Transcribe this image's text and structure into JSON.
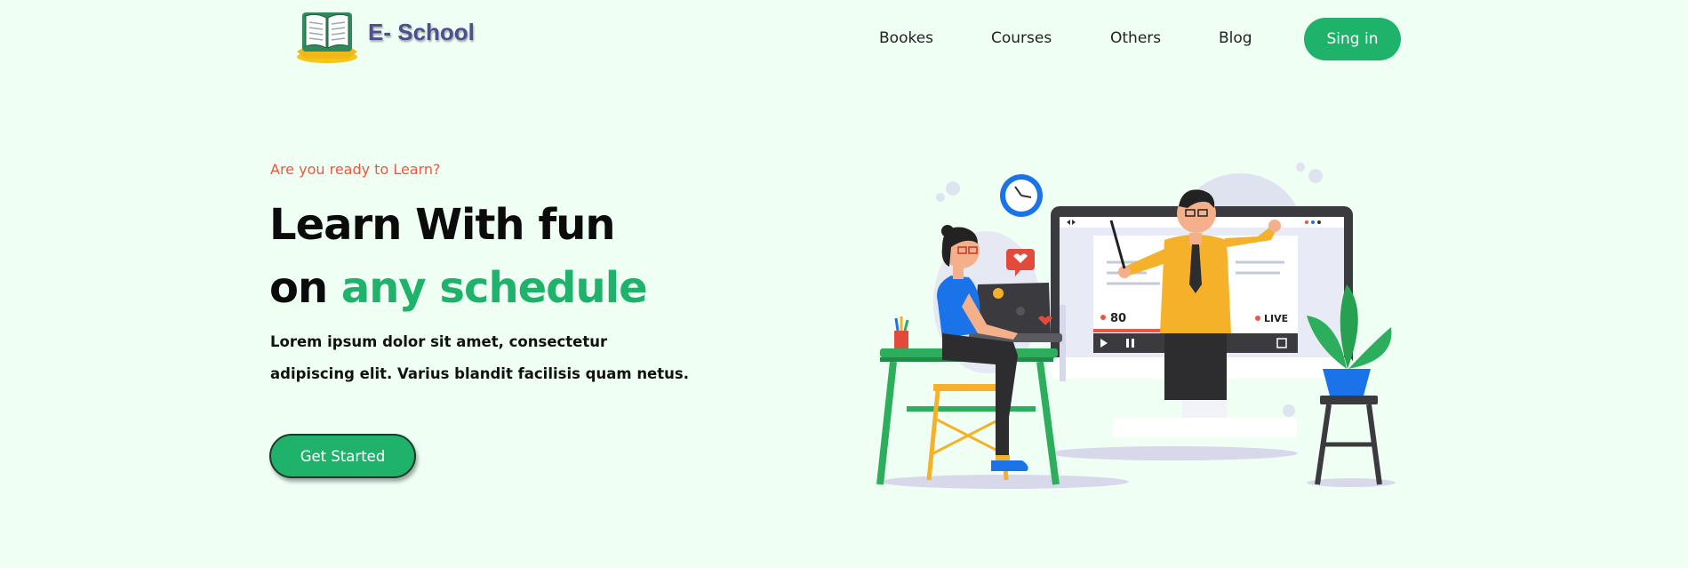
{
  "header": {
    "logo_text": "E- School",
    "nav": [
      {
        "label": "Bookes"
      },
      {
        "label": "Courses"
      },
      {
        "label": "Others"
      },
      {
        "label": "Blog"
      }
    ],
    "signin_label": "Sing in"
  },
  "hero": {
    "eyebrow": "Are you ready to Learn?",
    "title_line1": "Learn With fun",
    "title_line2_prefix": "on ",
    "title_line2_accent": "any schedule",
    "description_line1": "Lorem ipsum dolor sit amet, consectetur",
    "description_line2": "adipiscing elit. Varius blandit facilisis quam netus.",
    "cta_label": "Get Started"
  },
  "illustration": {
    "viewer_count": "80",
    "live_label": "LIVE"
  },
  "colors": {
    "background": "#f0fff4",
    "brand_green": "#1fb26b",
    "eyebrow_red": "#f0563f",
    "logo_purple": "#4e4f8f"
  }
}
